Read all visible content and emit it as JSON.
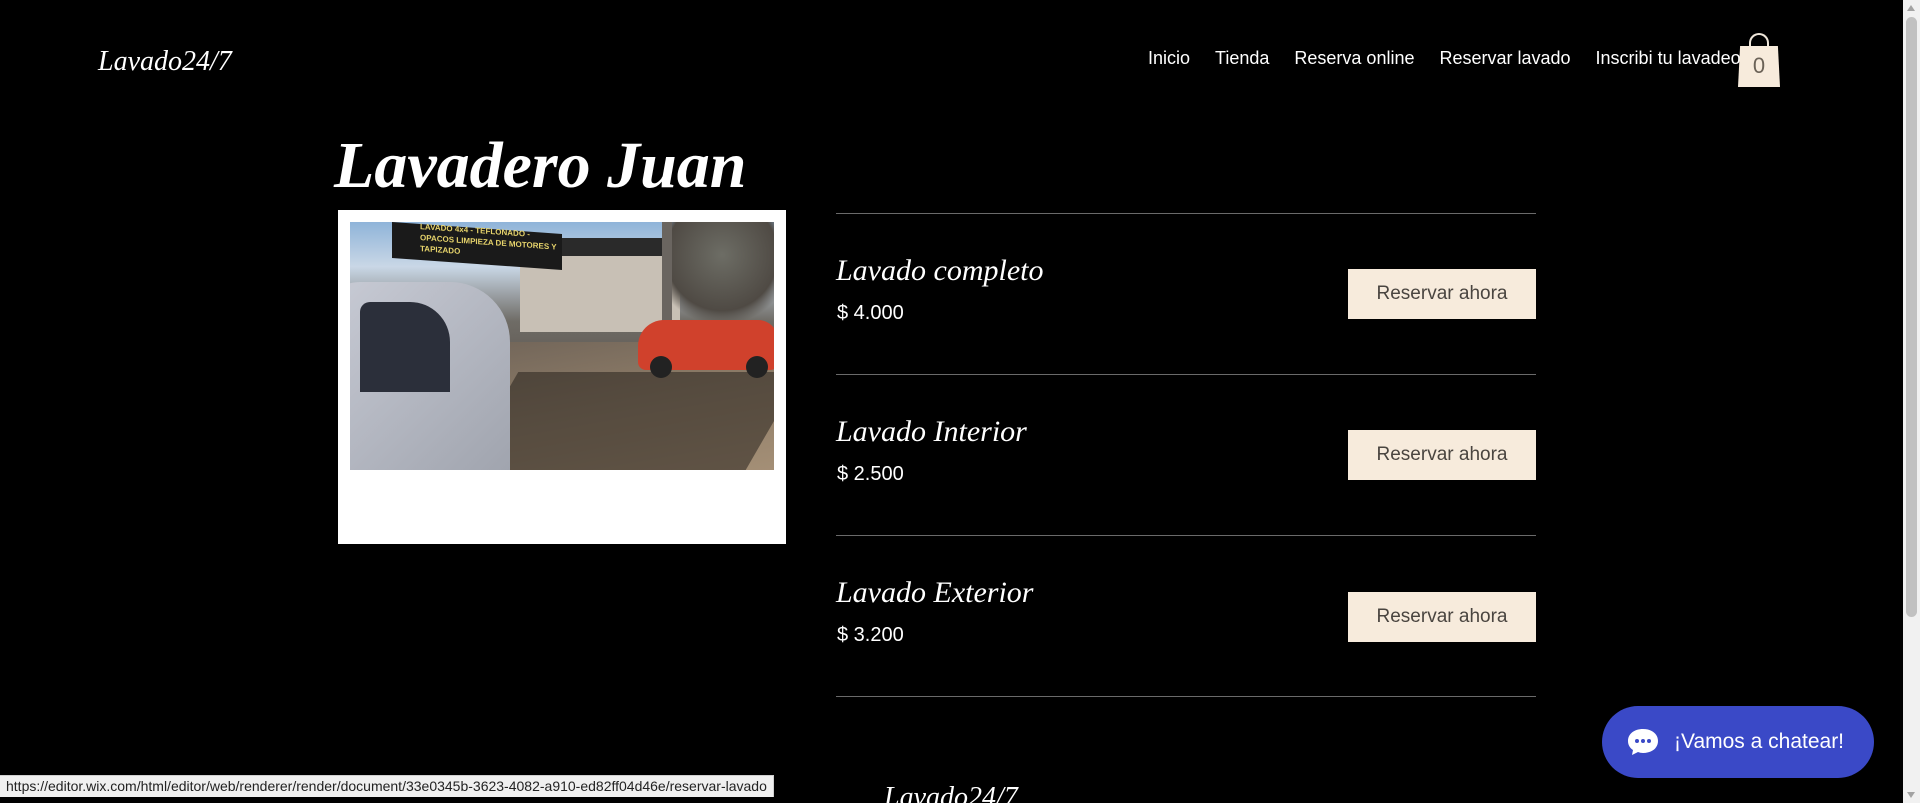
{
  "header": {
    "logo": "Lavado24/7",
    "nav": [
      "Inicio",
      "Tienda",
      "Reserva online",
      "Reservar lavado",
      "Inscribi tu lavadeor"
    ],
    "cart_count": "0"
  },
  "main": {
    "title": "Lavadero Juan",
    "photo_sign": "LAVADO 4x4 - TEFLONADO - OPACOS LIMPIEZA DE MOTORES Y TAPIZADO",
    "services": [
      {
        "name": "Lavado completo",
        "price": "$ 4.000",
        "button": "Reservar ahora"
      },
      {
        "name": "Lavado Interior",
        "price": "$ 2.500",
        "button": "Reservar ahora"
      },
      {
        "name": "Lavado Exterior",
        "price": "$ 3.200",
        "button": "Reservar ahora"
      }
    ]
  },
  "footer": {
    "logo": "Lavado24/7"
  },
  "status_bar": {
    "url": "https://editor.wix.com/html/editor/web/renderer/render/document/33e0345b-3623-4082-a910-ed82ff04d46e/reservar-lavado"
  },
  "chat": {
    "label": "¡Vamos a chatear!"
  },
  "colors": {
    "background": "#000000",
    "button": "#f7ebdc",
    "chat": "#3a49c7"
  }
}
